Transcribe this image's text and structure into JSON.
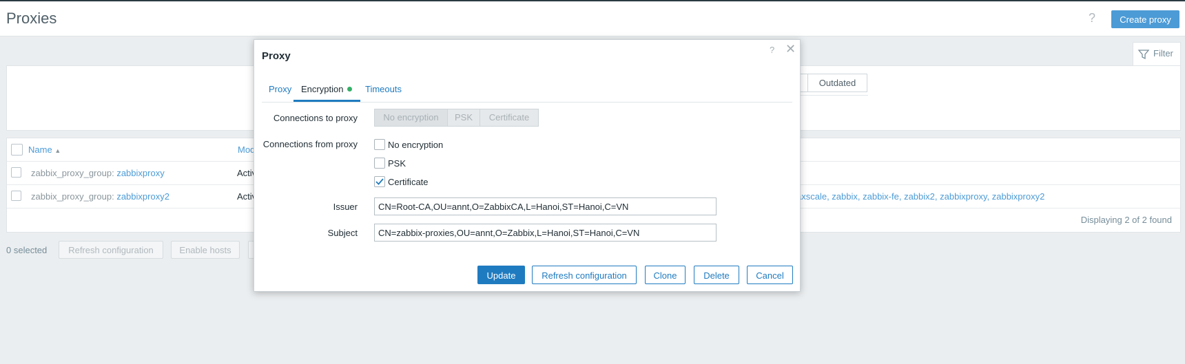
{
  "page": {
    "title": "Proxies",
    "help": "?",
    "create_button": "Create proxy",
    "filter_label": "Filter",
    "filter_outdated": "Outdated"
  },
  "table": {
    "header_name": "Name",
    "header_mode": "Mod",
    "rows": [
      {
        "group": "zabbix_proxy_group",
        "sep": ":",
        "name": "zabbixproxy",
        "mode": "Activ",
        "hosts": ""
      },
      {
        "group": "zabbix_proxy_group",
        "sep": ":",
        "name": "zabbixproxy2",
        "mode": "Activ",
        "hosts": "axscale, zabbix, zabbix-fe, zabbix2, zabbixproxy, zabbixproxy2"
      }
    ],
    "displaying": "Displaying 2 of 2 found"
  },
  "bottom": {
    "selected": "0 selected",
    "refresh_config": "Refresh configuration",
    "enable_hosts": "Enable hosts"
  },
  "modal": {
    "title": "Proxy",
    "help": "?",
    "close": "✕",
    "tabs": [
      {
        "label": "Proxy"
      },
      {
        "label": "Encryption"
      },
      {
        "label": "Timeouts"
      }
    ],
    "connections_to_label": "Connections to proxy",
    "connections_to_options": [
      "No encryption",
      "PSK",
      "Certificate"
    ],
    "connections_from_label": "Connections from proxy",
    "from_no_encryption": "No encryption",
    "from_psk": "PSK",
    "from_certificate": "Certificate",
    "issuer_label": "Issuer",
    "issuer_value": "CN=Root-CA,OU=annt,O=ZabbixCA,L=Hanoi,ST=Hanoi,C=VN",
    "subject_label": "Subject",
    "subject_value": "CN=zabbix-proxies,OU=annt,O=Zabbix,L=Hanoi,ST=Hanoi,C=VN",
    "buttons": {
      "update": "Update",
      "refresh": "Refresh configuration",
      "clone": "Clone",
      "delete": "Delete",
      "cancel": "Cancel"
    }
  }
}
